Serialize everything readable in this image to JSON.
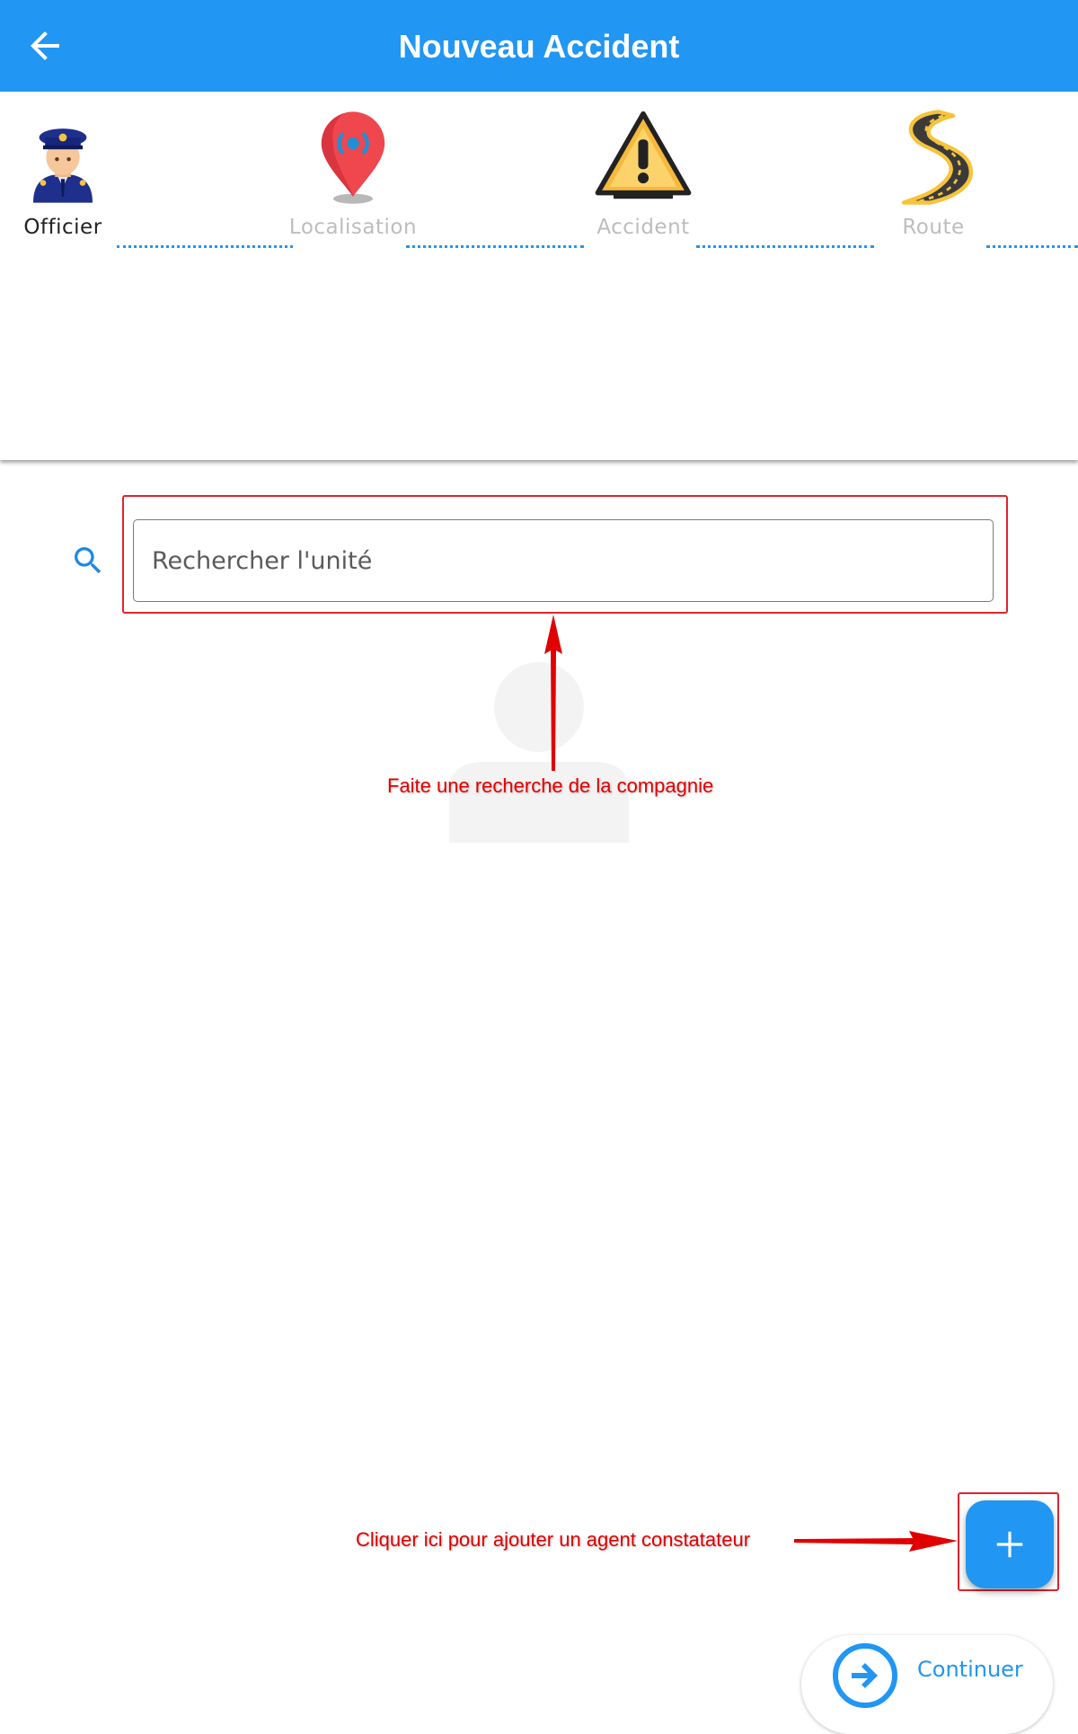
{
  "appbar": {
    "title": "Nouveau Accident",
    "back_icon": "arrow-left-icon",
    "background": "#2196F3"
  },
  "stepper": {
    "steps": [
      {
        "label": "Officier",
        "icon": "police-officer-icon",
        "active": true
      },
      {
        "label": "Localisation",
        "icon": "location-pin-icon",
        "active": false
      },
      {
        "label": "Accident",
        "icon": "warning-triangle-icon",
        "active": false
      },
      {
        "label": "Route",
        "icon": "winding-road-icon",
        "active": false
      }
    ],
    "connector_color": "#2196F3"
  },
  "search": {
    "placeholder": "Rechercher l'unité",
    "value": "",
    "icon": "search-icon"
  },
  "annotations": {
    "search_hint": "Faite une recherche de la compagnie",
    "add_hint": "Cliquer ici pour ajouter un agent constatateur",
    "color": "#e00000"
  },
  "fab": {
    "icon": "plus-icon"
  },
  "continue_button": {
    "label": "Continuer",
    "icon": "arrow-right-circle-icon"
  }
}
